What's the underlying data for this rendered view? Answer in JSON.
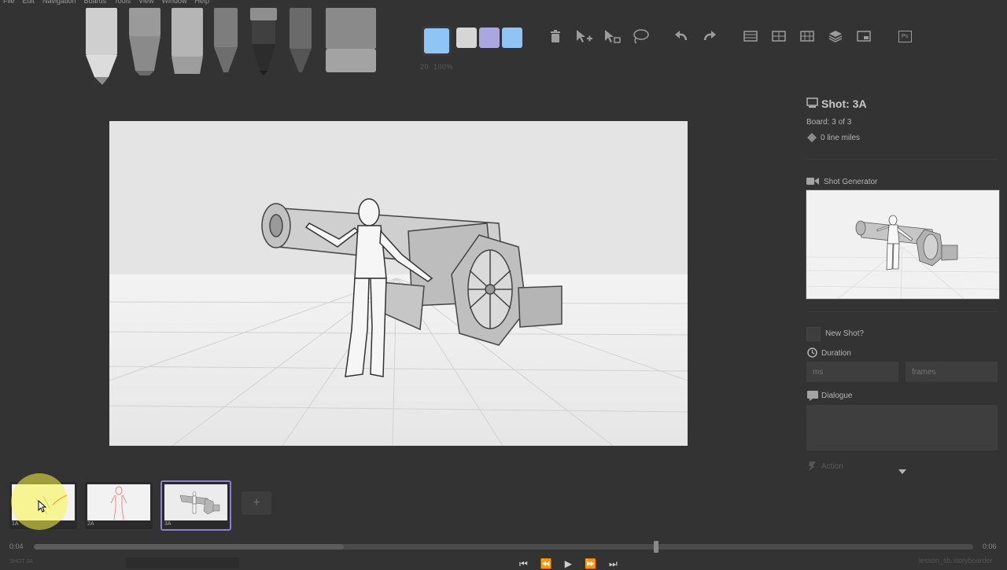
{
  "menu": [
    "File",
    "Edit",
    "Navigation",
    "Boards",
    "Tools",
    "View",
    "Window",
    "Help"
  ],
  "colors": {
    "swatch_active": "#8ec5f5",
    "swatch_2": "#d6d6d6",
    "swatch_3": "#a9a6e0",
    "swatch_4": "#8ec5f5",
    "selected_border": "#8b7fd6"
  },
  "brush": {
    "size": "20",
    "opacity": "100%"
  },
  "toolbar_icons": [
    "trash-icon",
    "add-pointer-icon",
    "move-pointer-icon",
    "lasso-icon",
    "undo-icon",
    "redo-icon",
    "grid-layout-1-icon",
    "grid-layout-2-icon",
    "grid-layout-3-icon",
    "layers-icon",
    "window-icon",
    "photoshop-icon"
  ],
  "toolbar_ps": "Ps",
  "shot": {
    "title": "Shot: 3A",
    "board": "Board: 3 of 3",
    "line_miles": "0 line miles"
  },
  "shot_generator": {
    "label": "Shot Generator"
  },
  "form": {
    "new_shot": "New Shot?",
    "duration": "Duration",
    "ms_placeholder": "ms",
    "frames_placeholder": "frames",
    "dialogue": "Dialogue",
    "action": "Action"
  },
  "boards": [
    {
      "label": "1A"
    },
    {
      "label": "2A"
    },
    {
      "label": "3A"
    }
  ],
  "add_label": "+",
  "timeline": {
    "start": "0:04",
    "end": "0:06",
    "progress": 0.33
  },
  "status": {
    "left": "SHOT 3A",
    "right": "lesson_sb.storyboarder"
  }
}
